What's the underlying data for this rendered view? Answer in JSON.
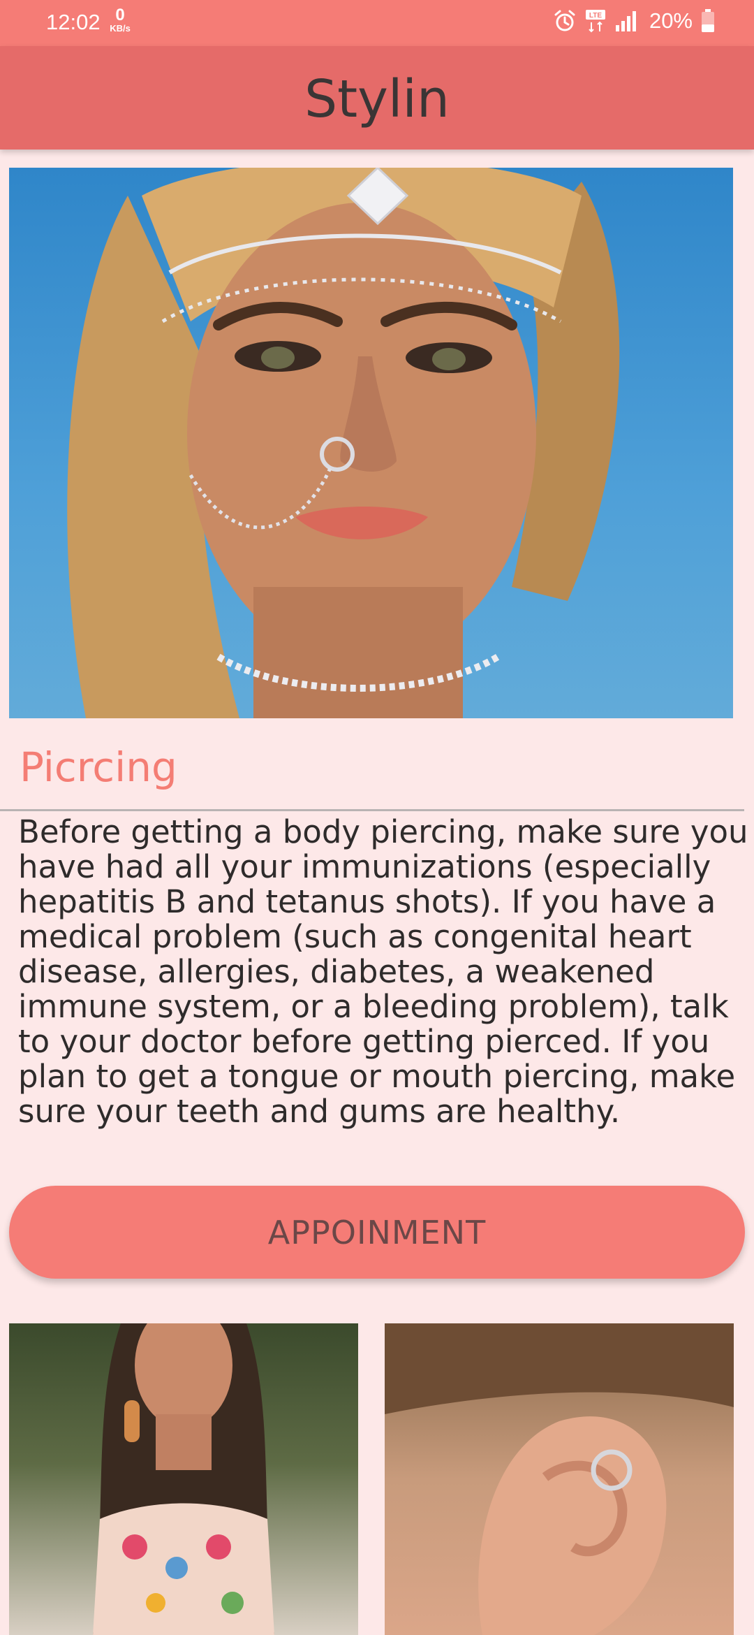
{
  "status_bar": {
    "time": "12:02",
    "speed_value": "0",
    "speed_unit": "KB/s",
    "network_label": "LTE",
    "battery_percent": "20%",
    "icons": [
      "alarm-icon",
      "lte-icon",
      "signal-icon",
      "battery-icon"
    ]
  },
  "app_bar": {
    "title": "Stylin"
  },
  "hero": {
    "image": "woman-with-head-chain-and-nose-piercing"
  },
  "content": {
    "section_title": "Picrcing",
    "description": "Before getting a body piercing, make sure you have had all your immunizations (especially hepatitis B and tetanus shots). If you have a medical problem (such as congenital heart disease, allergies, diabetes, a weakened immune system, or a bleeding problem), talk to your doctor before getting pierced. If you plan to get a tongue or mouth piercing, make sure your teeth and gums are healthy.",
    "button_label": "APPOINMENT"
  },
  "gallery": [
    {
      "image": "woman-with-earrings-and-floral-top"
    },
    {
      "image": "ear-with-helix-ring"
    }
  ],
  "colors": {
    "status_bar": "#f57c76",
    "app_bar": "#e56b69",
    "background": "#fde8e8",
    "accent": "#f47d74",
    "button": "#f57c76"
  }
}
